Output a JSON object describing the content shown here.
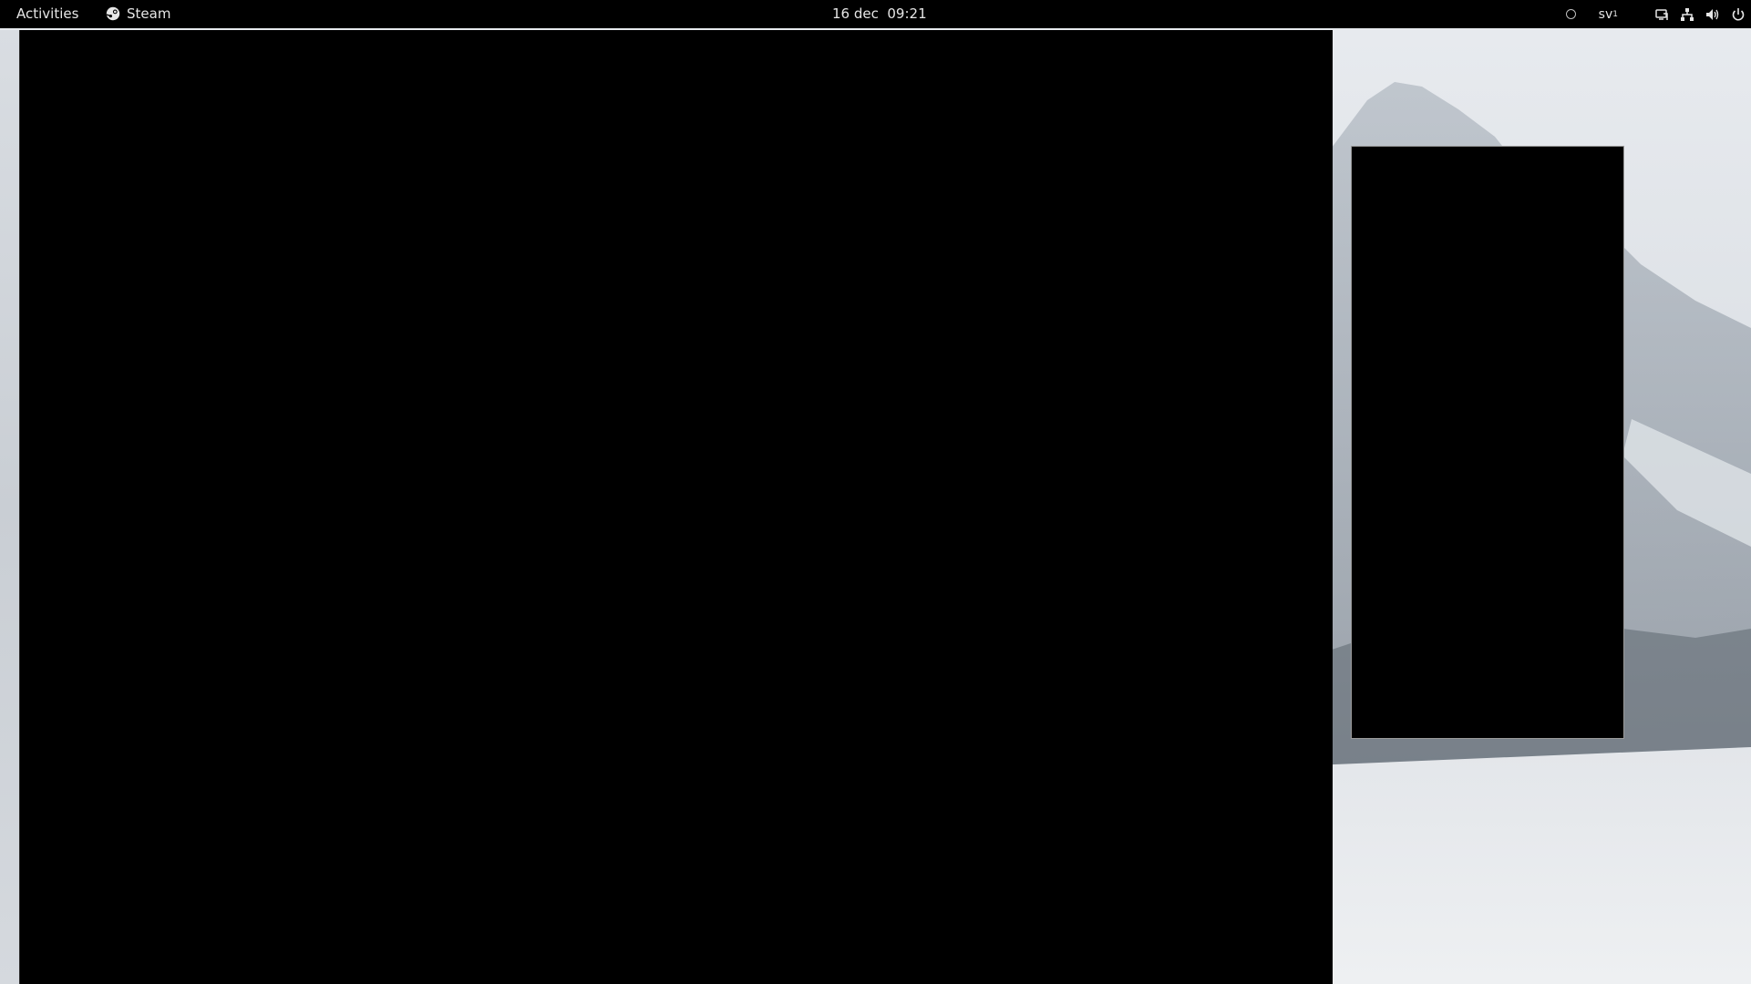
{
  "topbar": {
    "activities_label": "Activities",
    "app_name": "Steam",
    "app_icon": "steam-icon",
    "clock": "16 dec  09:21",
    "status_indicator_icon": "circle-status-icon",
    "keyboard_layout": "sv",
    "keyboard_layout_index": "1",
    "system_icons": [
      "screen-share-icon",
      "network-wired-icon",
      "volume-icon",
      "power-icon"
    ]
  },
  "desktop": {
    "wallpaper": "snowy-mountain-forest"
  },
  "windows": {
    "main": {
      "content": ""
    },
    "secondary": {
      "content": ""
    }
  }
}
